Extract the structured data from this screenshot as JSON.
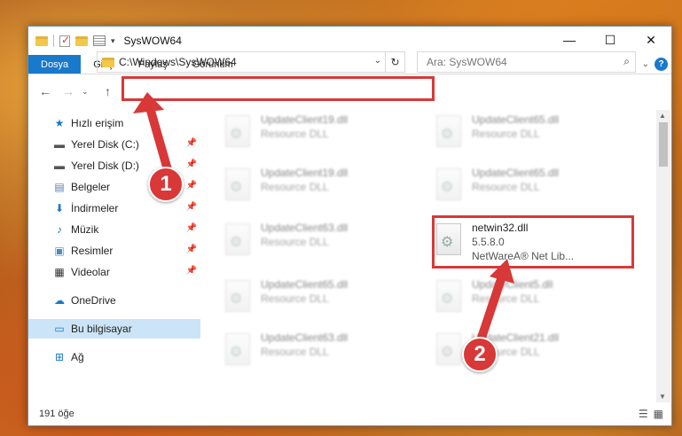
{
  "window": {
    "title": "SysWOW64",
    "minimize_label": "—",
    "maximize_label": "☐",
    "close_label": "✕"
  },
  "ribbon": {
    "tabs": [
      "Dosya",
      "Giriş",
      "Paylaş",
      "Görünüm"
    ],
    "accent": "#1979ca"
  },
  "address": {
    "path": "C:\\Windows\\SysWOW64"
  },
  "search": {
    "placeholder": "Ara: SysWOW64"
  },
  "sidebar": {
    "items": [
      {
        "label": "Hızlı erişim",
        "icon": "star-icon"
      },
      {
        "label": "Yerel Disk (C:)",
        "icon": "drive-icon",
        "pinned": true
      },
      {
        "label": "Yerel Disk (D:)",
        "icon": "drive-icon",
        "pinned": true
      },
      {
        "label": "Belgeler",
        "icon": "documents-icon",
        "pinned": true
      },
      {
        "label": "İndirmeler",
        "icon": "download-icon",
        "pinned": true
      },
      {
        "label": "Müzik",
        "icon": "music-icon",
        "pinned": true
      },
      {
        "label": "Resimler",
        "icon": "pictures-icon",
        "pinned": true
      },
      {
        "label": "Videolar",
        "icon": "videos-icon",
        "pinned": true
      },
      {
        "label": "OneDrive",
        "icon": "cloud-icon"
      },
      {
        "label": "Bu bilgisayar",
        "icon": "computer-icon",
        "selected": true
      },
      {
        "label": "Ağ",
        "icon": "network-icon"
      }
    ]
  },
  "files": [
    {
      "name": "UpdateClient19.dll",
      "sub": "Resource DLL"
    },
    {
      "name": "UpdateClient65.dll",
      "sub": "Resource DLL"
    },
    {
      "name": "UpdateClient19.dll",
      "sub": "Resource DLL"
    },
    {
      "name": "UpdateClient65.dll",
      "sub": "Resource DLL"
    },
    {
      "name": "UpdateClient63.dll",
      "sub": "Resource DLL"
    },
    {
      "name": "netwin32.dll",
      "version": "5.5.8.0",
      "sub": "NetWareA® Net Lib...",
      "highlighted": true
    },
    {
      "name": "UpdateClient65.dll",
      "sub": "Resource DLL"
    },
    {
      "name": "UpdateClient5.dll",
      "sub": "Resource DLL"
    },
    {
      "name": "UpdateClient63.dll",
      "sub": "Resource DLL"
    },
    {
      "name": "UpdateClient21.dll",
      "sub": "Resource DLL"
    }
  ],
  "status": {
    "count": "191 öğe"
  },
  "callouts": {
    "one": "1",
    "two": "2",
    "color": "#d83838"
  }
}
